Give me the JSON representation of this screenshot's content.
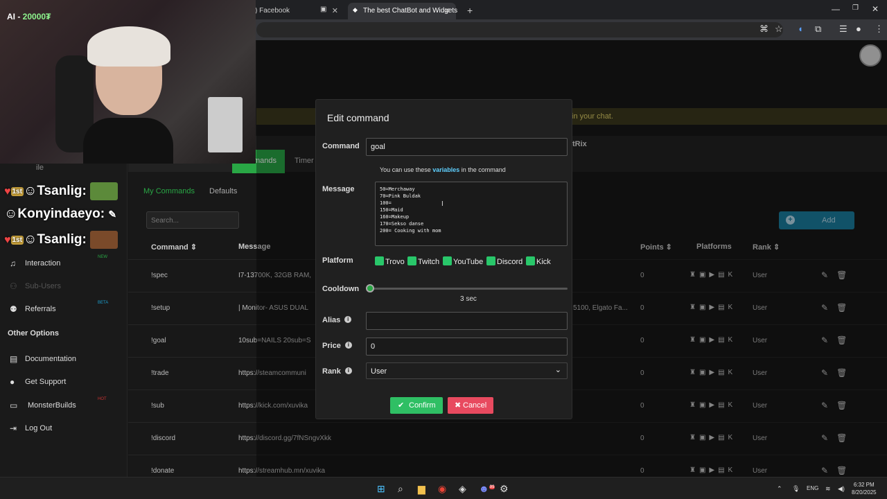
{
  "browser": {
    "tabs": [
      {
        "label": ") Facebook"
      },
      {
        "label": "The best ChatBot and Widgets"
      }
    ]
  },
  "stream": {
    "cam_label_prefix": "AI - ",
    "cam_label_value": "20000₮",
    "chat": [
      {
        "user": "Tsanlig:",
        "badge": "1st"
      },
      {
        "user": "Konyindaeyo:"
      },
      {
        "user": "Tsanlig:",
        "badge": "1st"
      }
    ]
  },
  "page": {
    "banner": "in your chat.",
    "panel_title": "tRix",
    "tabs": {
      "commands": "mands",
      "timers": "Timer"
    },
    "subtabs": {
      "my": "My Commands",
      "defaults": "Defaults"
    },
    "search_placeholder": "Search...",
    "add_label": "Add",
    "columns": {
      "command": "Command ⇕",
      "message": "Message",
      "points": "Points ⇕",
      "platforms": "Platforms",
      "rank": "Rank ⇕"
    },
    "rows": [
      {
        "cmd": "!spec",
        "msg": "I7-13700K, 32GB RAM,",
        "points": "0",
        "rank": "User"
      },
      {
        "cmd": "!setup",
        "msg": "| Monitor- ASUS DUAL",
        "extra": "5100, Elgato Fa...",
        "points": "0",
        "rank": "User"
      },
      {
        "cmd": "!goal",
        "msg": "10sub=NAILS 20sub=S",
        "points": "0",
        "rank": "User"
      },
      {
        "cmd": "!trade",
        "msg": "https://steamcommuni",
        "points": "0",
        "rank": "User"
      },
      {
        "cmd": "!sub",
        "msg": "https://kick.com/xuvika",
        "points": "0",
        "rank": "User"
      },
      {
        "cmd": "!discord",
        "msg": "https://discord.gg/7fNSngvXkk",
        "points": "0",
        "rank": "User"
      },
      {
        "cmd": "!donate",
        "msg": "https://streamhub.mn/xuvika",
        "points": "0",
        "rank": "User"
      }
    ]
  },
  "sidebar": {
    "profile": "ile",
    "items": [
      {
        "label": "Interaction",
        "badge": "NEW"
      },
      {
        "label": "Sub-Users"
      },
      {
        "label": "Referrals",
        "badge": "BETA"
      }
    ],
    "section": "Other Options",
    "other": [
      {
        "label": "Documentation"
      },
      {
        "label": "Get Support"
      },
      {
        "label": "MonsterBuilds",
        "badge": "HOT"
      },
      {
        "label": "Log Out"
      }
    ]
  },
  "modal": {
    "title": "Edit command",
    "command_label": "Command",
    "command_value": "goal",
    "hint_prefix": "You can use these ",
    "hint_link": "variables",
    "hint_suffix": " in the command",
    "message_label": "Message",
    "message_value": "50=Merchaway\n70=Pink Buldak\n100=\n150=Maid\n160=Makeup\n170=Sekso danse\n200= Cooking with mom",
    "platform_label": "Platform",
    "platforms": [
      "Trovo",
      "Twitch",
      "YouTube",
      "Discord",
      "Kick"
    ],
    "cooldown_label": "Cooldown",
    "cooldown_value": "3 sec",
    "alias_label": "Alias",
    "alias_value": "",
    "price_label": "Price",
    "price_value": "0",
    "rank_label": "Rank",
    "rank_value": "User",
    "confirm": "Confirm",
    "cancel": "Cancel"
  },
  "taskbar": {
    "lang": "ENG",
    "time": "6:32 PM",
    "date": "8/20/2025",
    "discord_badge": "99"
  },
  "colors": {
    "accent_green": "#29a745",
    "danger": "#e84a5f",
    "info": "#1b7fa0",
    "link": "#5fd0ff"
  }
}
